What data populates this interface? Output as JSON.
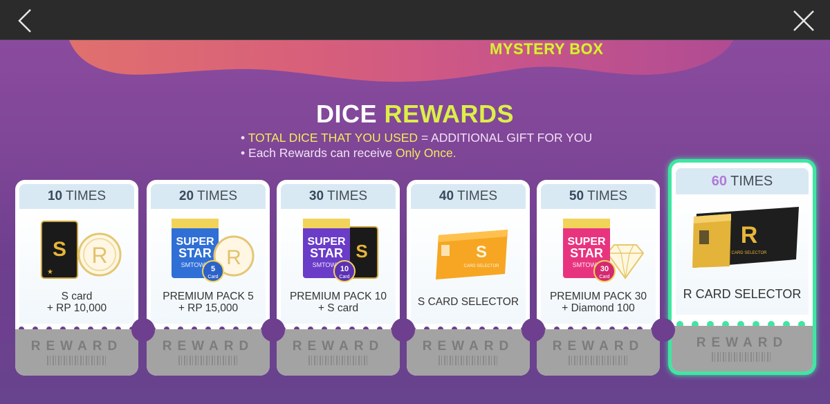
{
  "event": {
    "banner_title": "MYSTERY BOX",
    "heading_main": "DICE",
    "heading_accent": "REWARDS"
  },
  "info": {
    "line1_bullet": "•",
    "line1_highlight": "TOTAL DICE THAT YOU USED",
    "line1_rest": " = ADDITIONAL GIFT FOR YOU",
    "line2_bullet": "•",
    "line2_text": "Each Rewards can receive ",
    "line2_highlight": "Only Once."
  },
  "times_suffix": "TIMES",
  "reward_label": "REWARD",
  "cards": [
    {
      "count": "10",
      "label_line1": "S card",
      "label_line2": "+ RP 10,000"
    },
    {
      "count": "20",
      "label_line1": "PREMIUM PACK 5",
      "label_line2": "+ RP 15,000"
    },
    {
      "count": "30",
      "label_line1": "PREMIUM PACK 10",
      "label_line2": "+ S card"
    },
    {
      "count": "40",
      "label_line1": "S CARD SELECTOR",
      "label_line2": ""
    },
    {
      "count": "50",
      "label_line1": "PREMIUM PACK 30",
      "label_line2": "+ Diamond 100"
    },
    {
      "count": "60",
      "label_line1": "R CARD SELECTOR",
      "label_line2": ""
    }
  ],
  "art_text": {
    "s_letter": "S",
    "r_letter": "R",
    "super": "SUPER",
    "star": "STAR",
    "smtown": "SMTOWN",
    "pack5_num": "5",
    "pack10_num": "10",
    "pack30_num": "30",
    "card_word": "Card",
    "card_selector": "CARD SELECTOR"
  },
  "colors": {
    "accent_yellow": "#dcef48",
    "highlight_green": "#3fe6a2",
    "purple_bg": "#6e3f8f"
  },
  "icons": {
    "back": "chevron-left-icon",
    "close": "close-icon"
  }
}
